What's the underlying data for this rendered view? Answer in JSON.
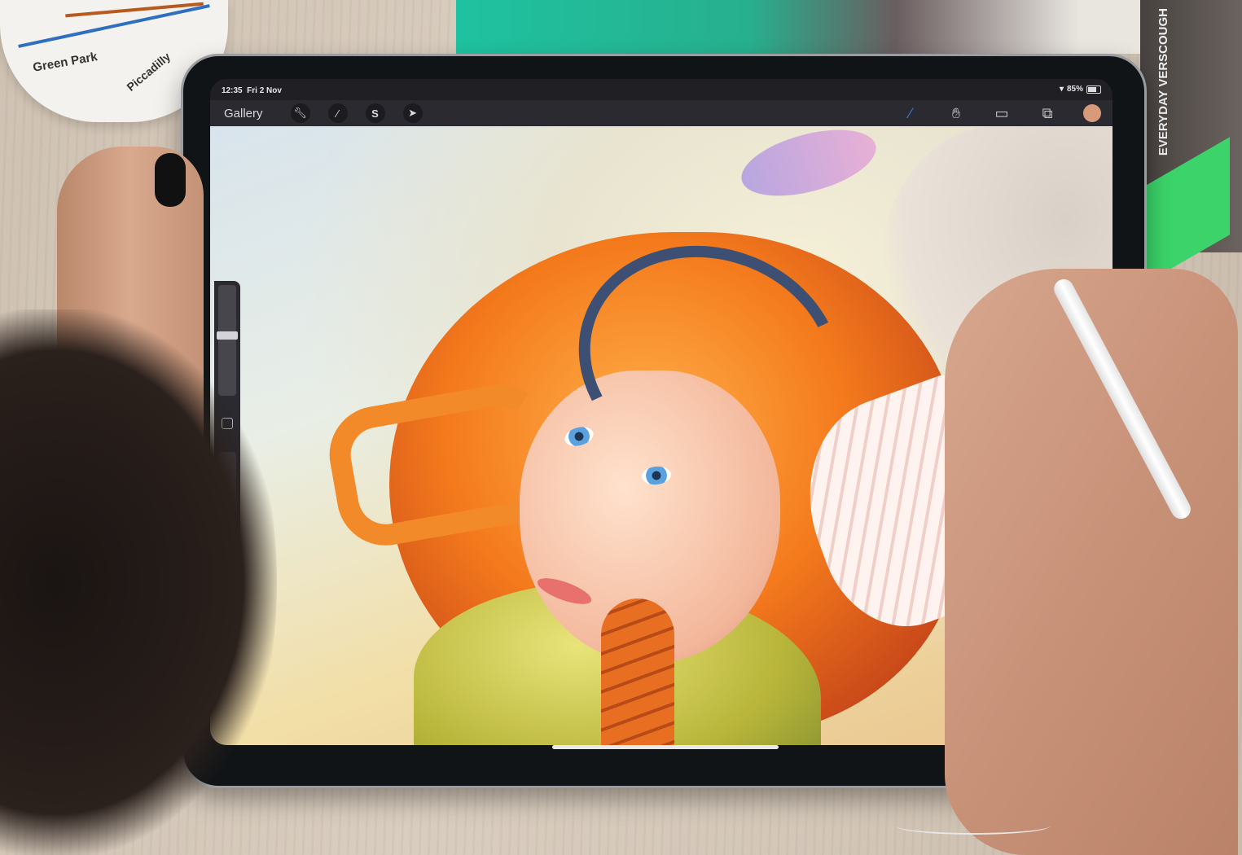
{
  "scene": {
    "mug_text": [
      "Green Park",
      "Piccadilly"
    ],
    "book_text": "EVERYDAY VERSCOUGH"
  },
  "status_bar": {
    "time": "12:35",
    "date": "Fri 2 Nov",
    "battery": "85%",
    "battery_fraction": 0.85
  },
  "toolbar": {
    "gallery_label": "Gallery",
    "left_tools": [
      "wrench-icon",
      "magic-wand-icon",
      "selection-s-icon",
      "transform-arrow-icon"
    ],
    "right_tools": [
      "brush-icon",
      "smudge-icon",
      "eraser-icon",
      "layers-icon"
    ],
    "current_color": "#d99a7c",
    "brush_active_color": "#3a78d8"
  },
  "sidebar": {
    "brush_size_fraction": 0.55,
    "opacity_fraction": 0.12
  }
}
